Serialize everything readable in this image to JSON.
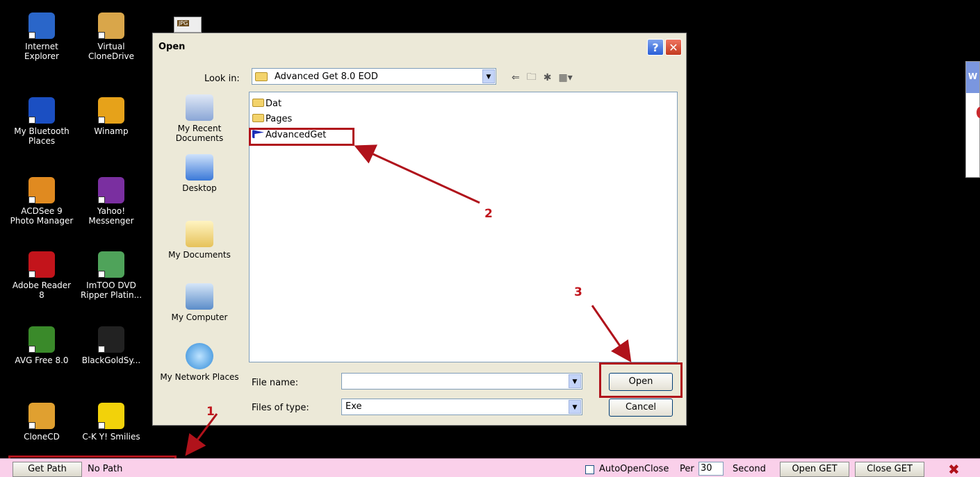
{
  "desktop_icons": [
    {
      "name": "ie",
      "label_lines": [
        "Internet",
        "Explorer"
      ],
      "color": "#2a66c9"
    },
    {
      "name": "virtual-clonedrive",
      "label_lines": [
        "Virtual",
        "CloneDrive"
      ],
      "color": "#d9a64a"
    },
    {
      "name": "bluetooth",
      "label_lines": [
        "My Bluetooth",
        "Places"
      ],
      "color": "#1b4fc2"
    },
    {
      "name": "winamp",
      "label_lines": [
        "Winamp",
        ""
      ],
      "color": "#e6a21a"
    },
    {
      "name": "acdsee",
      "label_lines": [
        "ACDSee 9",
        "Photo Manager"
      ],
      "color": "#e08a20"
    },
    {
      "name": "yahoo-messenger",
      "label_lines": [
        "Yahoo!",
        "Messenger"
      ],
      "color": "#7a2fa0"
    },
    {
      "name": "adobe-reader",
      "label_lines": [
        "Adobe Reader",
        "8"
      ],
      "color": "#c3141b"
    },
    {
      "name": "imtoo-dvd",
      "label_lines": [
        "ImTOO DVD",
        "Ripper Platin..."
      ],
      "color": "#4fa35a"
    },
    {
      "name": "avg-free",
      "label_lines": [
        "AVG Free 8.0",
        ""
      ],
      "color": "#3a8a2a"
    },
    {
      "name": "blackgoldsy",
      "label_lines": [
        "BlackGoldSy...",
        ""
      ],
      "color": "#222222"
    },
    {
      "name": "clonecd",
      "label_lines": [
        "CloneCD",
        ""
      ],
      "color": "#e0a030"
    },
    {
      "name": "cky-smilies",
      "label_lines": [
        "C-K Y! Smilies",
        ""
      ],
      "color": "#f2d20a"
    }
  ],
  "dialog": {
    "title": "Open",
    "help_glyph": "?",
    "close_glyph": "✕",
    "look_in_label": "Look in:",
    "look_in_value": "Advanced Get 8.0 EOD",
    "places": [
      "My Recent Documents",
      "Desktop",
      "My Documents",
      "My Computer",
      "My Network Places"
    ],
    "files": [
      {
        "name": "Dat",
        "type": "folder"
      },
      {
        "name": "Pages",
        "type": "folder"
      },
      {
        "name": "AdvancedGet",
        "type": "exe"
      }
    ],
    "file_name_label": "File name:",
    "file_name_value": "",
    "file_type_label": "Files of type:",
    "file_type_value": "Exe",
    "open_button": "Open",
    "cancel_button": "Cancel"
  },
  "annotations": {
    "one": "1",
    "two": "2",
    "three": "3",
    "color": "#b0121b"
  },
  "bottom_bar": {
    "get_path_button": "Get Path",
    "path_text": "No Path",
    "auto_open_close_label": "AutoOpenClose",
    "per_label": "Per",
    "per_value": "30",
    "second_label": "Second",
    "open_get_button": "Open GET",
    "close_get_button": "Close GET",
    "close_glyph": "✖"
  },
  "partial_window": {
    "title_char": "W"
  },
  "jpg_icon_badge": "JPG"
}
